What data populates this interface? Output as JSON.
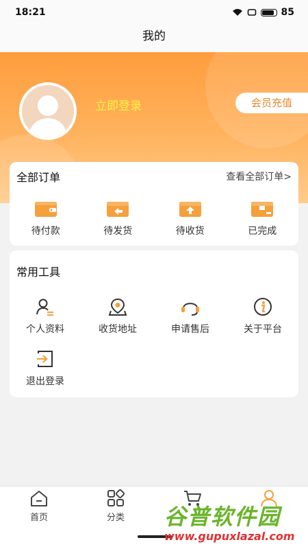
{
  "status_bar": {
    "time": "18:21",
    "battery": "85"
  },
  "header": {
    "title": "我的"
  },
  "profile": {
    "login_label": "立即登录",
    "vip_button_label": "会员充值"
  },
  "orders": {
    "title": "全部订单",
    "view_all_label": "查看全部订单>",
    "items": [
      {
        "label": "待付款",
        "icon": "wallet-icon"
      },
      {
        "label": "待发货",
        "icon": "ship-box-icon"
      },
      {
        "label": "待收货",
        "icon": "receive-box-icon"
      },
      {
        "label": "已完成",
        "icon": "completed-box-icon"
      }
    ]
  },
  "tools": {
    "title": "常用工具",
    "items": [
      {
        "label": "个人资料",
        "icon": "user-profile-icon"
      },
      {
        "label": "收货地址",
        "icon": "location-pin-icon"
      },
      {
        "label": "申请售后",
        "icon": "headset-icon"
      },
      {
        "label": "关于平台",
        "icon": "info-icon"
      },
      {
        "label": "退出登录",
        "icon": "logout-icon"
      }
    ]
  },
  "tabbar": {
    "items": [
      {
        "label": "首页",
        "icon": "home-icon"
      },
      {
        "label": "分类",
        "icon": "category-icon"
      },
      {
        "label": "",
        "icon": "cart-icon"
      },
      {
        "label": "",
        "icon": "user-icon"
      }
    ]
  },
  "watermark": {
    "name": "谷普软件园",
    "url": "www.gupuxlazal.com"
  },
  "colors": {
    "accent": "#ff9d3c",
    "login_text": "#fff341",
    "icon_orange": "#f5a03c"
  }
}
